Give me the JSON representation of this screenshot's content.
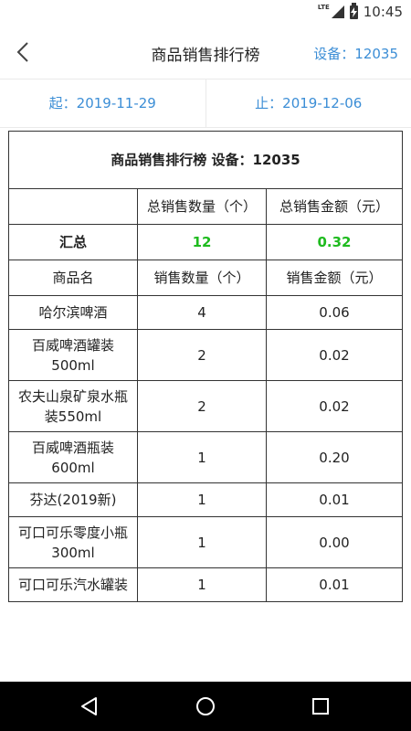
{
  "status": {
    "network": "LTE",
    "time": "10:45"
  },
  "header": {
    "title": "商品销售排行榜",
    "device": "设备：12035"
  },
  "dates": {
    "start": "起：2019-11-29",
    "end": "止：2019-12-06"
  },
  "report": {
    "title": "商品销售排行榜 设备：12035",
    "total_qty_header": "总销售数量（个）",
    "total_amount_header": "总销售金额（元）",
    "summary_label": "汇总",
    "summary_qty": "12",
    "summary_amount": "0.32",
    "col_name": "商品名",
    "col_qty": "销售数量（个）",
    "col_amount": "销售金额（元）",
    "rows": [
      {
        "name": "哈尔滨啤酒",
        "qty": "4",
        "amount": "0.06"
      },
      {
        "name": "百威啤酒罐装500ml",
        "qty": "2",
        "amount": "0.02"
      },
      {
        "name": "农夫山泉矿泉水瓶装550ml",
        "qty": "2",
        "amount": "0.02"
      },
      {
        "name": "百威啤酒瓶装600ml",
        "qty": "1",
        "amount": "0.20"
      },
      {
        "name": "芬达(2019新)",
        "qty": "1",
        "amount": "0.01"
      },
      {
        "name": "可口可乐零度小瓶300ml",
        "qty": "1",
        "amount": "0.00"
      },
      {
        "name": "可口可乐汽水罐装",
        "qty": "1",
        "amount": "0.01"
      }
    ]
  },
  "colors": {
    "accent": "#3c8ed6",
    "highlight": "#1fbb1f"
  },
  "nav": {
    "icons": [
      "back-triangle-icon",
      "home-circle-icon",
      "recents-square-icon"
    ]
  }
}
